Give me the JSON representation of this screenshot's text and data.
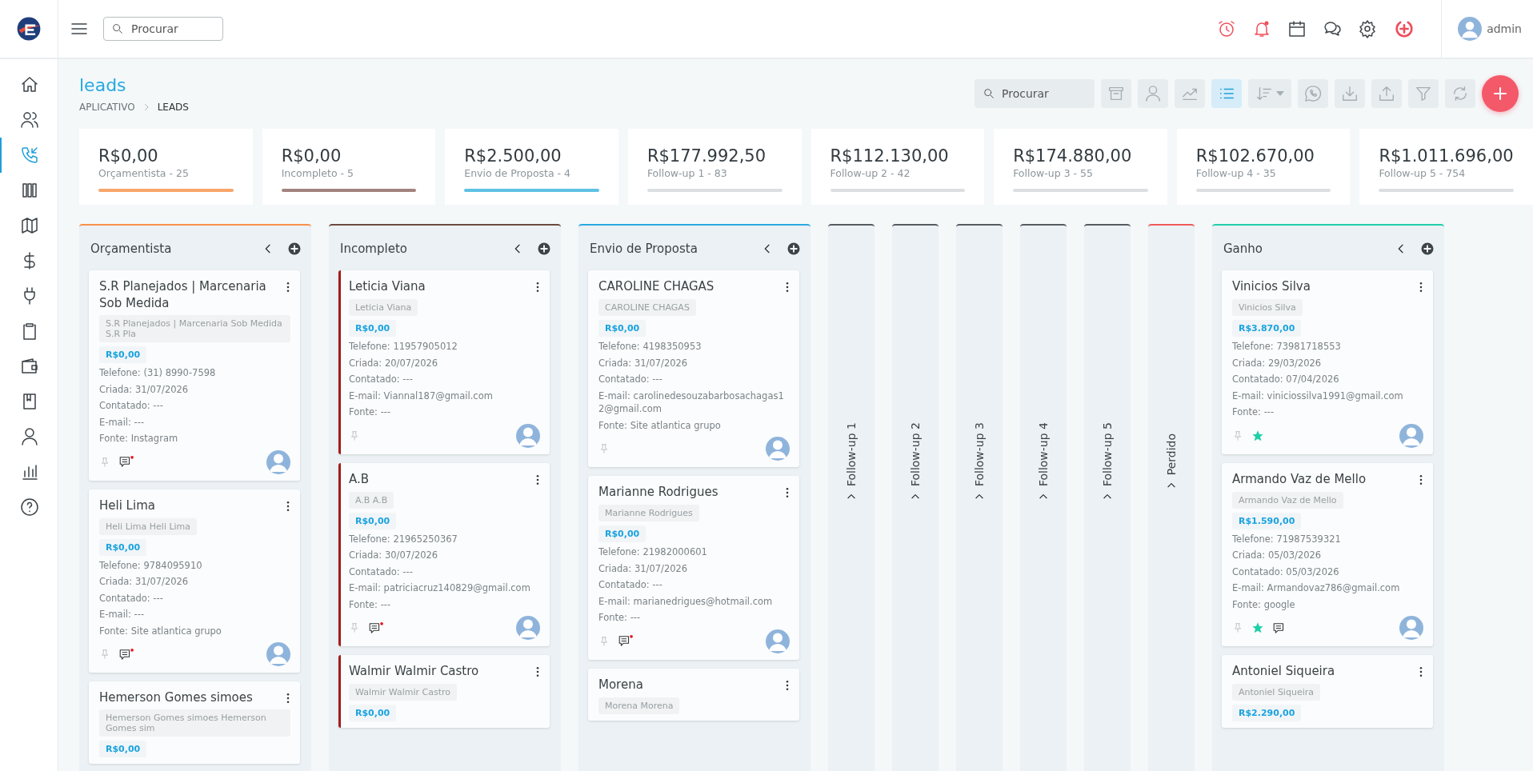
{
  "topbar": {
    "search": {
      "placeholder": "Procurar"
    },
    "user": "admin"
  },
  "sidebar": {
    "items": [
      {
        "selected": false
      },
      {
        "selected": false
      },
      {
        "selected": true
      },
      {
        "selected": false
      },
      {
        "selected": false
      },
      {
        "selected": false
      },
      {
        "selected": false
      },
      {
        "selected": false
      },
      {
        "selected": false
      },
      {
        "selected": false
      },
      {
        "selected": false
      },
      {
        "selected": false
      },
      {
        "selected": false
      }
    ]
  },
  "page": {
    "title": "leads",
    "breadcrumb": [
      "APLICATIVO",
      "LEADS"
    ]
  },
  "toolbar": {
    "search": {
      "placeholder": "Procurar"
    },
    "buttons": [
      {
        "selected": false
      },
      {
        "selected": false
      },
      {
        "selected": false
      },
      {
        "selected": true
      },
      {
        "selected": false
      },
      {
        "selected": false
      },
      {
        "selected": false
      },
      {
        "selected": false
      },
      {
        "selected": false
      },
      {
        "selected": false
      }
    ]
  },
  "stats": [
    {
      "value": "R$0,00",
      "label": "Orçamentista - 25",
      "color": "#f8a66a"
    },
    {
      "value": "R$0,00",
      "label": "Incompleto - 5",
      "color": "#a3837f"
    },
    {
      "value": "R$2.500,00",
      "label": "Envio de Proposta - 4",
      "color": "#5ec1e4"
    },
    {
      "value": "R$177.992,50",
      "label": "Follow-up 1 - 83",
      "color": "#dcdfe2"
    },
    {
      "value": "R$112.130,00",
      "label": "Follow-up 2 - 42",
      "color": "#dcdfe2"
    },
    {
      "value": "R$174.880,00",
      "label": "Follow-up 3 - 55",
      "color": "#dcdfe2"
    },
    {
      "value": "R$102.670,00",
      "label": "Follow-up 4 - 35",
      "color": "#dcdfe2"
    },
    {
      "value": "R$1.011.696,00",
      "label": "Follow-up 5 - 754",
      "color": "#dcdfe2"
    }
  ],
  "columns": [
    {
      "kind": "expanded",
      "title": "Orçamentista",
      "color": "#f8914a",
      "cards": [
        {
          "title": "S.R Planejados | Marcenaria Sob Medida",
          "tag": "S.R Planejados | Marcenaria Sob Medida S.R Pla",
          "value": "R$0,00",
          "lines": [
            "Telefone: (31) 8990-7598",
            "Criada: 31/07/2026",
            "Contatado: ---",
            "E-mail: ---",
            "Fonte: Instagram"
          ],
          "flagged": false,
          "starred": false,
          "comments": true,
          "unread": true
        },
        {
          "title": "Heli Lima",
          "tag": "Heli Lima Heli Lima",
          "value": "R$0,00",
          "lines": [
            "Telefone: 9784095910",
            "Criada: 31/07/2026",
            "Contatado: ---",
            "E-mail: ---",
            "Fonte: Site atlantica grupo"
          ],
          "flagged": false,
          "starred": false,
          "comments": true,
          "unread": true
        },
        {
          "title": "Hemerson Gomes simoes",
          "tag": "Hemerson Gomes simoes Hemerson Gomes sim",
          "value": "R$0,00",
          "flagged": false
        }
      ]
    },
    {
      "kind": "expanded",
      "title": "Incompleto",
      "color": "#6b4a3e",
      "cards": [
        {
          "title": "Leticia Viana",
          "tag": "Leticia Viana",
          "value": "R$0,00",
          "lines": [
            "Telefone: 11957905012",
            "Criada: 20/07/2026",
            "Contatado: ---",
            "E-mail: Viannal187@gmail.com",
            "Fonte: ---"
          ],
          "flagged": true,
          "starred": false,
          "comments": false
        },
        {
          "title": "A.B",
          "tag": "A.B A.B",
          "value": "R$0,00",
          "lines": [
            "Telefone: 21965250367",
            "Criada: 30/07/2026",
            "Contatado: ---",
            "E-mail: patriciacruz140829@gmail.com",
            "Fonte: ---"
          ],
          "flagged": true,
          "starred": false,
          "comments": true,
          "unread": true
        },
        {
          "title": "Walmir Walmir Castro",
          "tag": "Walmir Walmir Castro",
          "value": "R$0,00",
          "flagged": true
        }
      ]
    },
    {
      "kind": "expanded",
      "title": "Envio de Proposta",
      "color": "#2aa9e0",
      "cards": [
        {
          "title": "CAROLINE CHAGAS",
          "tag": "CAROLINE CHAGAS",
          "value": "R$0,00",
          "lines": [
            "Telefone: 4198350953",
            "Criada: 31/07/2026",
            "Contatado: ---",
            "E-mail: carolinedesouzabarbosachagas12@gmail.com",
            "Fonte: Site atlantica grupo"
          ],
          "flagged": false,
          "starred": false,
          "comments": false
        },
        {
          "title": "Marianne Rodrigues",
          "tag": "Marianne Rodrigues",
          "value": "R$0,00",
          "lines": [
            "Telefone: 21982000601",
            "Criada: 31/07/2026",
            "Contatado: ---",
            "E-mail: marianedrigues@hotmail.com",
            "Fonte: ---"
          ],
          "flagged": false,
          "starred": false,
          "comments": true,
          "unread": true
        },
        {
          "title": "Morena",
          "tag": "Morena Morena",
          "flagged": false
        }
      ]
    },
    {
      "kind": "collapsed",
      "title": "Follow-up 1",
      "color": "#555b60"
    },
    {
      "kind": "collapsed",
      "title": "Follow-up 2",
      "color": "#555b60"
    },
    {
      "kind": "collapsed",
      "title": "Follow-up 3",
      "color": "#555b60"
    },
    {
      "kind": "collapsed",
      "title": "Follow-up 4",
      "color": "#555b60"
    },
    {
      "kind": "collapsed",
      "title": "Follow-up 5",
      "color": "#555b60"
    },
    {
      "kind": "collapsed",
      "title": "Perdido",
      "color": "#f05a5a"
    },
    {
      "kind": "expanded",
      "title": "Ganho",
      "color": "#1fcfa8",
      "cards": [
        {
          "title": "Vinicios Silva",
          "tag": "Vinicios Silva",
          "value": "R$3.870,00",
          "lines": [
            "Telefone: 73981718553",
            "Criada: 29/03/2026",
            "Contatado: 07/04/2026",
            "E-mail: viniciossilva1991@gmail.com",
            "Fonte: ---"
          ],
          "flagged": false,
          "starred": true,
          "comments": false
        },
        {
          "title": "Armando Vaz de Mello",
          "tag": "Armando Vaz de Mello",
          "value": "R$1.590,00",
          "lines": [
            "Telefone: 71987539321",
            "Criada: 05/03/2026",
            "Contatado: 05/03/2026",
            "E-mail: Armandovaz786@gmail.com",
            "Fonte: google"
          ],
          "flagged": false,
          "starred": true,
          "comments": true,
          "unread": false
        },
        {
          "title": "Antoniel Siqueira",
          "tag": "Antoniel Siqueira",
          "value": "R$2.290,00",
          "flagged": false
        }
      ]
    }
  ]
}
